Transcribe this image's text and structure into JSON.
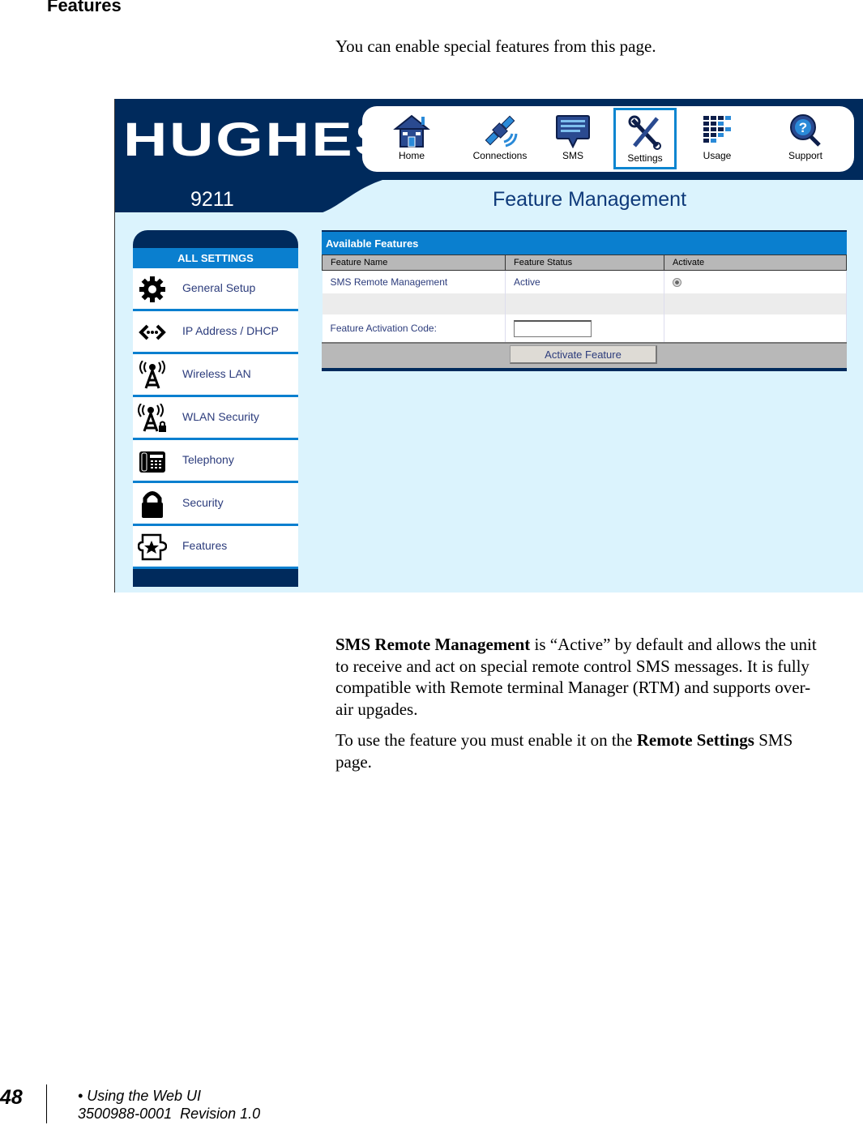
{
  "document": {
    "section_title": "Features",
    "intro": "You can enable special features from this page.",
    "body": {
      "p1_bold": "SMS Remote Management",
      "p1_rest": " is “Active” by default and allows the unit to receive and act on special remote control SMS messages. It is fully compatible with Remote terminal Manager (RTM) and supports over-air upgades.",
      "p2_start": "To use the feature you must enable it on the ",
      "p2_bold": "Remote Settings",
      "p2_end": " SMS page."
    },
    "footer": {
      "page_number": "48",
      "chapter": "• Using the Web UI",
      "doc_id": "3500988-0001  Revision 1.0"
    }
  },
  "screenshot": {
    "logo": "HUGHES",
    "model": "9211",
    "page_title": "Feature Management",
    "colors": {
      "navy": "#002a5c",
      "accent": "#0a7fcf",
      "bg": "#dbf3fd"
    },
    "nav": [
      {
        "label": "Home",
        "icon": "home-icon",
        "active": false
      },
      {
        "label": "Connections",
        "icon": "satellite-icon",
        "active": false
      },
      {
        "label": "SMS",
        "icon": "message-icon",
        "active": false
      },
      {
        "label": "Settings",
        "icon": "tools-icon",
        "active": true
      },
      {
        "label": "Usage",
        "icon": "usage-grid-icon",
        "active": false
      },
      {
        "label": "Support",
        "icon": "help-icon",
        "active": false
      }
    ],
    "sidebar": {
      "header": "ALL SETTINGS",
      "items": [
        {
          "label": "General Setup",
          "icon": "gear-icon"
        },
        {
          "label": "IP Address / DHCP",
          "icon": "network-arrows-icon"
        },
        {
          "label": "Wireless LAN",
          "icon": "antenna-icon"
        },
        {
          "label": "WLAN Security",
          "icon": "antenna-lock-icon"
        },
        {
          "label": "Telephony",
          "icon": "phone-icon"
        },
        {
          "label": "Security",
          "icon": "lock-icon"
        },
        {
          "label": "Features",
          "icon": "puzzle-star-icon"
        }
      ]
    },
    "panel": {
      "title": "Available Features",
      "columns": [
        "Feature Name",
        "Feature Status",
        "Activate"
      ],
      "rows": [
        {
          "name": "SMS Remote Management",
          "status": "Active",
          "activate_selected": true
        }
      ],
      "code_label": "Feature Activation Code:",
      "code_value": "",
      "activate_button": "Activate Feature"
    }
  }
}
